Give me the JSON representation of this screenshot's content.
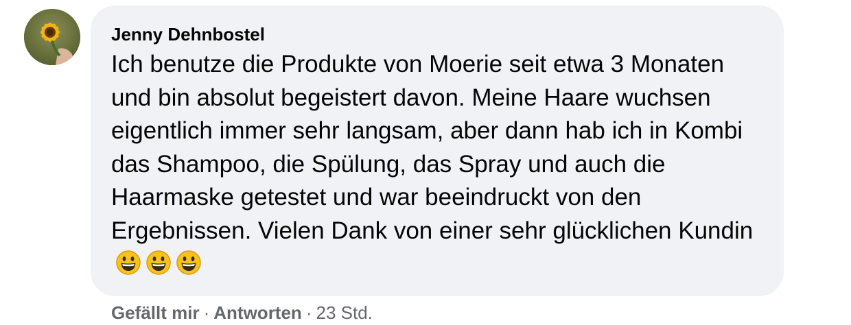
{
  "comment": {
    "author": "Jenny Dehnbostel",
    "text": "Ich benutze die Produkte von Moerie seit etwa 3 Monaten und bin absolut begeistert davon. Meine Haare wuchsen eigentlich immer sehr langsam, aber dann hab ich in Kombi das Shampoo, die Spülung, das Spray und auch die Haarmaske getestet und war beeindruckt von den Ergebnissen. Vielen Dank von einer sehr glücklichen Kundin",
    "emojis": [
      "grinning-face-emoji",
      "grinning-face-emoji",
      "grinning-face-emoji"
    ]
  },
  "actions": {
    "like_label": "Gefällt mir",
    "reply_label": "Antworten",
    "separator": "·",
    "timestamp": "23 Std."
  },
  "colors": {
    "bubble_bg": "#f0f2f5",
    "text": "#050505",
    "secondary": "#65676b"
  }
}
